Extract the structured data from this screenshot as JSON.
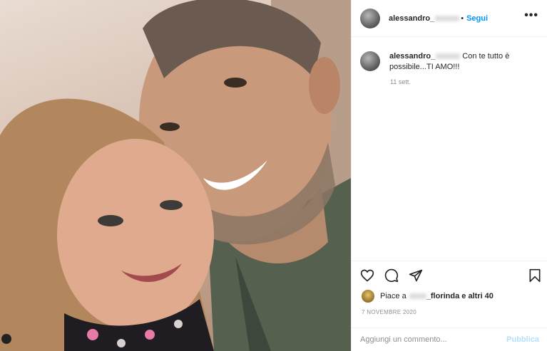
{
  "post": {
    "author_prefix": "alessandro",
    "author_suffix": "_",
    "follow_label": "Segui",
    "more_label": "•••",
    "caption_text": "Con te tutto è possibile...TI AMO!!!",
    "caption_time": "11 sett.",
    "likes": {
      "prefix": "Piace a",
      "user": "_florinda",
      "suffix": "e altri 40"
    },
    "date": "7 NOVEMBRE 2020",
    "comment_placeholder": "Aggiungi un commento...",
    "publish_label": "Pubblica"
  },
  "icons": {
    "like": "heart-icon",
    "comment": "comment-icon",
    "share": "share-icon",
    "save": "bookmark-icon",
    "more": "more-icon"
  },
  "colors": {
    "link_blue": "#0095f6",
    "publish_disabled": "#b2dffc",
    "muted_text": "#8e8e8e",
    "divider": "#efefef"
  }
}
